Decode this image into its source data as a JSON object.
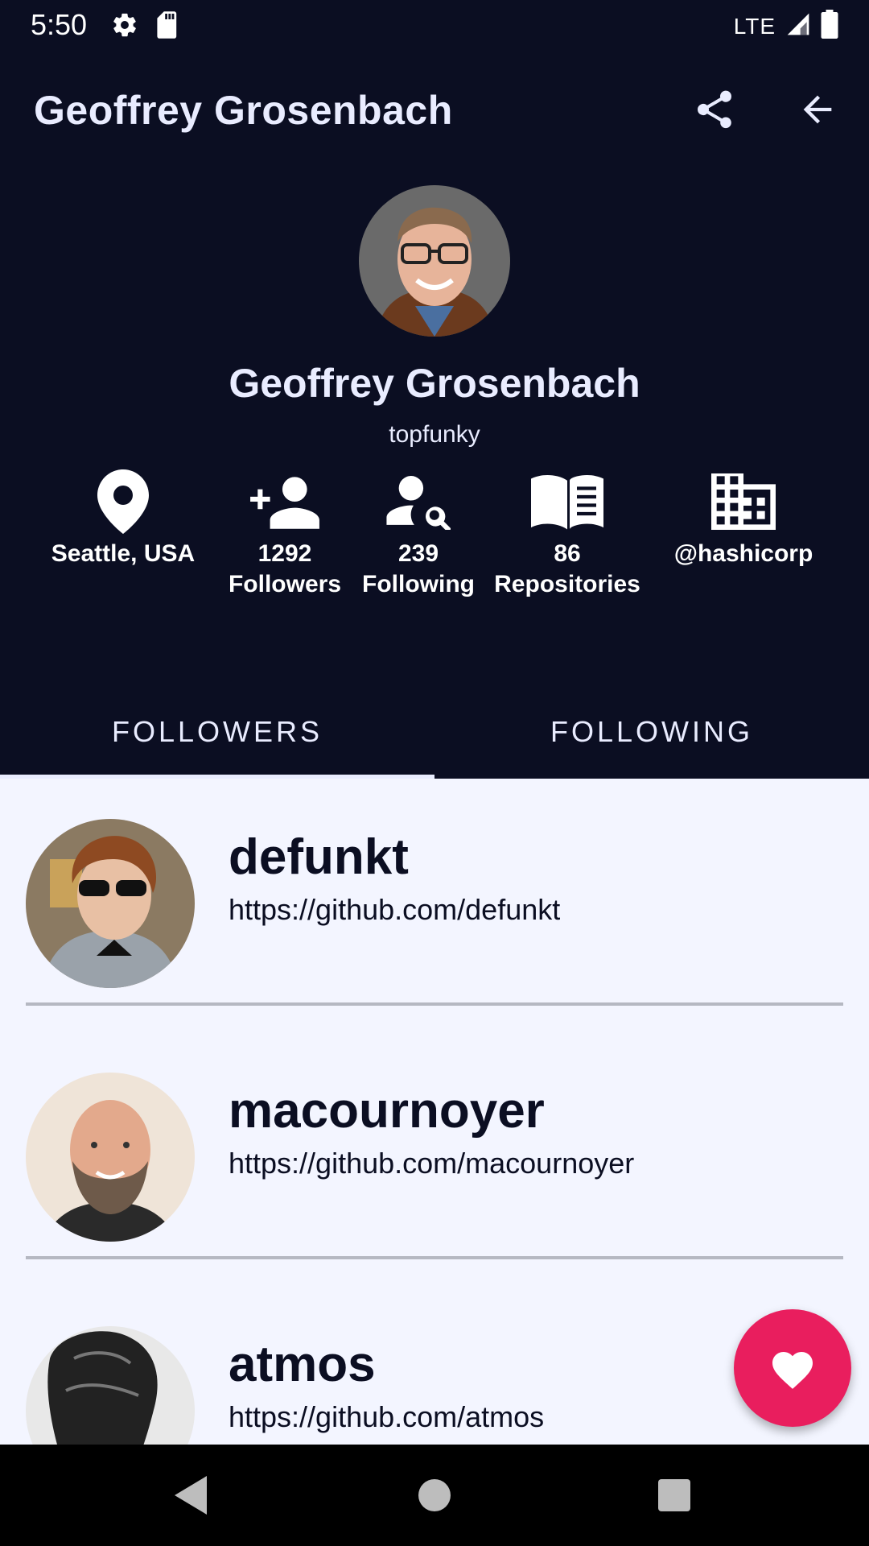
{
  "status_bar": {
    "time": "5:50",
    "network": "LTE",
    "icons": [
      "settings-icon",
      "sd-card-icon",
      "signal-icon",
      "battery-icon"
    ]
  },
  "app_bar": {
    "title": "Geoffrey Grosenbach",
    "actions": [
      "share-icon",
      "arrow-back-icon"
    ]
  },
  "profile": {
    "name": "Geoffrey Grosenbach",
    "login": "topfunky",
    "stats": [
      {
        "icon": "location-pin-icon",
        "line1": "Seattle, USA",
        "line2": ""
      },
      {
        "icon": "person-add-icon",
        "line1": "1292",
        "line2": "Followers"
      },
      {
        "icon": "person-search-icon",
        "line1": "239",
        "line2": "Following"
      },
      {
        "icon": "book-icon",
        "line1": "86",
        "line2": "Repositories"
      },
      {
        "icon": "company-building-icon",
        "line1": "@hashicorp",
        "line2": ""
      }
    ]
  },
  "tabs": [
    {
      "label": "FOLLOWERS",
      "selected": true
    },
    {
      "label": "FOLLOWING",
      "selected": false
    }
  ],
  "users": [
    {
      "name": "defunkt",
      "url": "https://github.com/defunkt"
    },
    {
      "name": "macournoyer",
      "url": "https://github.com/macournoyer"
    },
    {
      "name": "atmos",
      "url": "https://github.com/atmos"
    }
  ],
  "fab": {
    "icon": "heart-icon",
    "color": "#e91e5e"
  },
  "colors": {
    "background": "#0b0e22",
    "list_background": "#f3f5ff",
    "text_light": "#e9ecff"
  }
}
